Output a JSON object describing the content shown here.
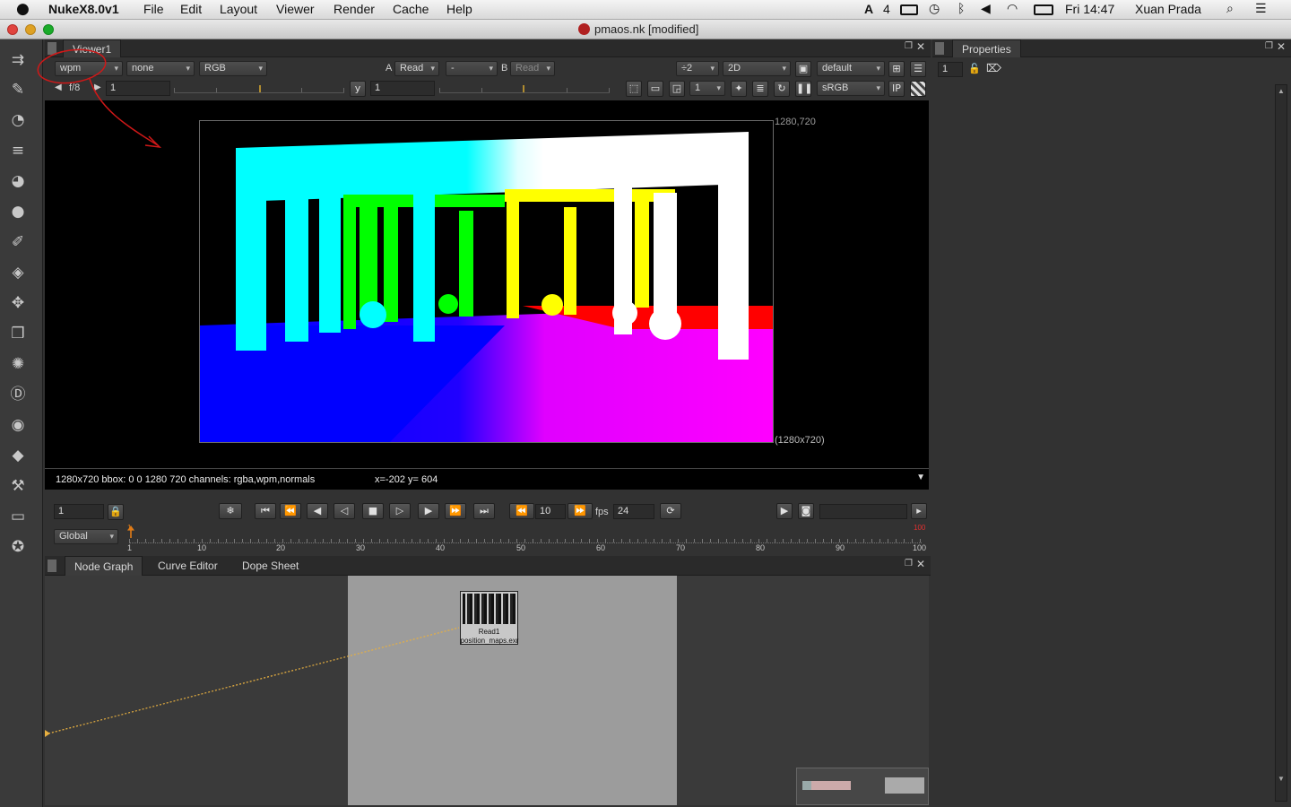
{
  "menubar": {
    "app": "NukeX8.0v1",
    "items": [
      "File",
      "Edit",
      "Layout",
      "Viewer",
      "Render",
      "Cache",
      "Help"
    ],
    "status": {
      "adobe": "4",
      "time": "Fri 14:47",
      "user": "Xuan Prada"
    }
  },
  "window": {
    "title": "pmaos.nk [modified]"
  },
  "viewer": {
    "tab": "Viewer1",
    "layer": "wpm",
    "layer2": "none",
    "channels": "RGB",
    "a_label": "A",
    "a_input": "Read",
    "a_op": "-",
    "b_label": "B",
    "b_input": "Read",
    "zoom": "÷2",
    "mode": "2D",
    "lut_preset": "default",
    "fstop": "f/8",
    "gain": "1",
    "gamma_label": "y",
    "gamma": "1",
    "proxy": "1",
    "colorspace": "sRGB",
    "ip": "IP",
    "gain_ticks": [
      "0.03125",
      "0.0625",
      "0.125",
      "0.25",
      "0.5",
      "1",
      "2",
      "4",
      "8",
      "16",
      "32",
      "64"
    ],
    "format_top": "1280,720",
    "format_bottom": "(1280x720)",
    "info": "1280x720 bbox: 0 0 1280 720 channels: rgba,wpm,normals",
    "coords": "x=-202 y= 604"
  },
  "timeline": {
    "frame": "1",
    "cur_frame": "10",
    "fps_label": "fps",
    "fps": "24",
    "range": "Global",
    "ticks": [
      "1",
      "10",
      "20",
      "30",
      "40",
      "50",
      "60",
      "70",
      "80",
      "90",
      "100"
    ],
    "end_marker": "100",
    "start_marker": "1"
  },
  "nodegraph": {
    "tabs": [
      "Node Graph",
      "Curve Editor",
      "Dope Sheet"
    ],
    "node": {
      "name": "Read1",
      "file": "position_maps.exr"
    }
  },
  "properties": {
    "tab": "Properties",
    "max_panels": "1"
  },
  "colors": {
    "cyan": "#00ffff",
    "blue": "#0000ff",
    "magenta": "#ff00ff",
    "green": "#00ff00",
    "yellow": "#ffff00",
    "red": "#ff0000",
    "annotation": "#d01818"
  }
}
